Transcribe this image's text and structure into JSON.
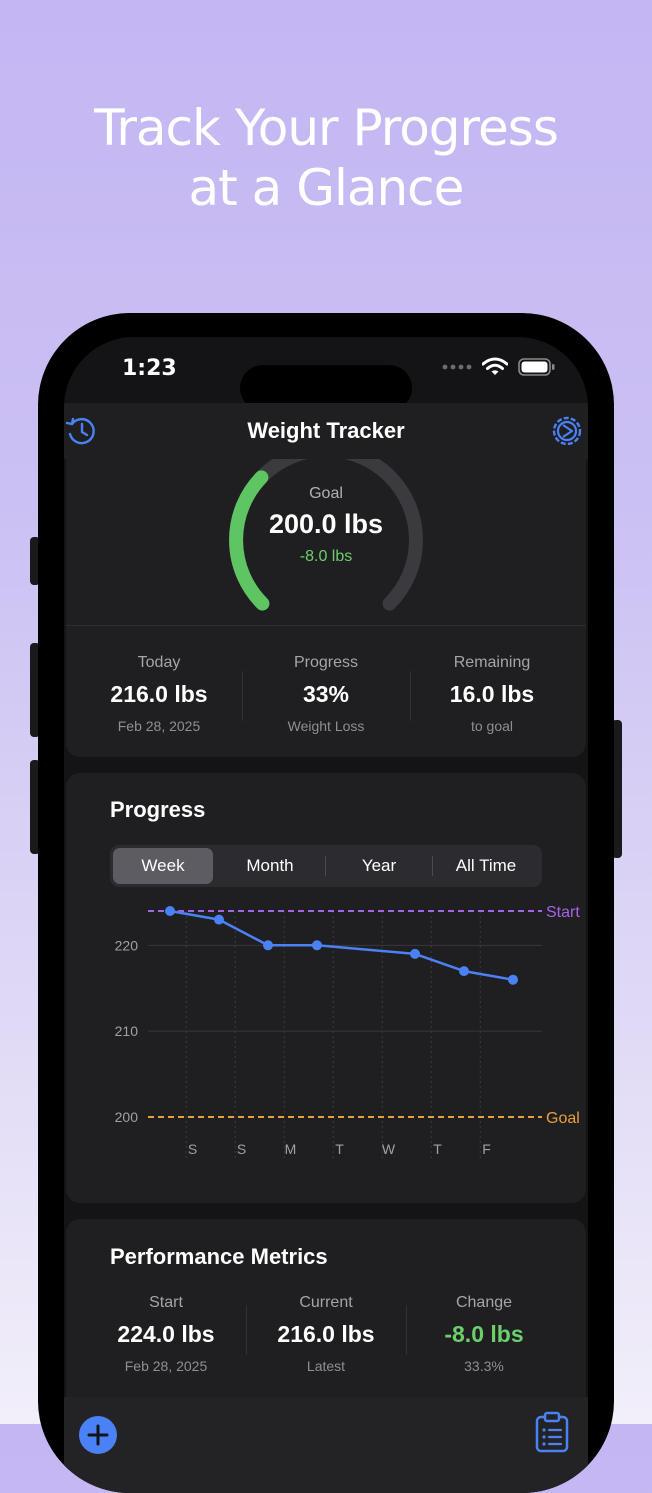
{
  "headline": {
    "line1": "Track Your Progress",
    "line2": "at a Glance"
  },
  "status_bar": {
    "time": "1:23",
    "icons": [
      "cellular-dots-icon",
      "wifi-icon",
      "battery-icon"
    ]
  },
  "nav": {
    "title": "Weight Tracker",
    "left_icon": "history-icon",
    "right_icon": "settings-icon"
  },
  "colors": {
    "accent_blue": "#4a82f5",
    "gauge_green": "#5fc462",
    "start_purple": "#a463e8",
    "goal_orange": "#e6a13b",
    "positive_green": "#6ccf6c"
  },
  "goal_card": {
    "gauge": {
      "label": "Goal",
      "value": "200.0 lbs",
      "delta": "-8.0 lbs",
      "progress_fraction": 0.33
    },
    "stats": [
      {
        "label": "Today",
        "value": "216.0 lbs",
        "sub": "Feb 28, 2025"
      },
      {
        "label": "Progress",
        "value": "33%",
        "sub": "Weight Loss"
      },
      {
        "label": "Remaining",
        "value": "16.0 lbs",
        "sub": "to goal"
      }
    ]
  },
  "progress_card": {
    "title": "Progress",
    "tabs": [
      {
        "label": "Week",
        "active": true
      },
      {
        "label": "Month",
        "active": false
      },
      {
        "label": "Year",
        "active": false
      },
      {
        "label": "All Time",
        "active": false
      }
    ]
  },
  "chart_data": {
    "type": "line",
    "x": [
      "S",
      "S",
      "M",
      "T",
      "W",
      "T",
      "F"
    ],
    "series": [
      {
        "values": [
          224.0,
          223.0,
          220.0,
          220.0,
          219.0,
          217.0,
          216.0
        ]
      }
    ],
    "point_positions": [
      -0.5,
      0.5,
      1.5,
      2.5,
      4.5,
      5.5,
      6.5
    ],
    "y_ticks": [
      200,
      210,
      220
    ],
    "ylim": [
      200,
      224
    ],
    "reference_lines": [
      {
        "label": "Start",
        "value": 224,
        "color": "#a463e8"
      },
      {
        "label": "Goal",
        "value": 200,
        "color": "#e6a13b"
      }
    ],
    "grid": true
  },
  "metrics_card": {
    "title": "Performance Metrics",
    "stats": [
      {
        "label": "Start",
        "value": "224.0 lbs",
        "sub": "Feb 28, 2025"
      },
      {
        "label": "Current",
        "value": "216.0 lbs",
        "sub": "Latest"
      },
      {
        "label": "Change",
        "value": "-8.0 lbs",
        "sub": "33.3%"
      }
    ]
  },
  "bottom_bar": {
    "left_icon": "plus-icon",
    "right_icon": "clipboard-icon"
  }
}
